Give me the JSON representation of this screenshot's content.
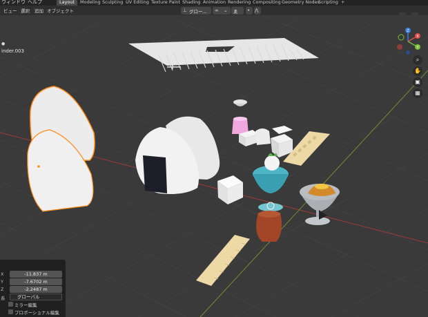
{
  "topbar": {
    "menus": [
      "ウィンドウ",
      "ヘルプ"
    ],
    "tabs": [
      "Layout",
      "Modeling",
      "Sculpting",
      "UV Editing",
      "Texture Paint",
      "Shading",
      "Animation",
      "Rendering",
      "Compositing",
      "Geometry Nodes",
      "Scripting"
    ],
    "active_tab": "Layout",
    "add_tab": "+"
  },
  "header": {
    "menus": [
      "ビュー",
      "選択",
      "追加",
      "オブジェクト"
    ],
    "orientation": "グロー...",
    "snap_label": "ゑ"
  },
  "viewport": {
    "object_name": "inder.003",
    "object_icon": "●",
    "nav_gizmo": {
      "x": "X",
      "y": "Y",
      "z": "Z"
    },
    "nav_buttons": [
      "zoom-icon",
      "hand-pan-icon",
      "camera-icon",
      "grid-icon"
    ]
  },
  "redo_panel": {
    "x_label": "X",
    "x_value": "-11.837 m",
    "y_label": "Y",
    "y_value": "-7.6702 m",
    "z_label": "Z",
    "z_value": "-2.2487 m",
    "orient_label": "系",
    "orient_value": "グローバル",
    "mirror_edit": "ミラー編集",
    "proportional_edit": "プロポーショナル編集"
  },
  "colors": {
    "background": "#3a3a3a",
    "grid": "#474747",
    "x_axis": "#a33a3a",
    "y_axis": "#7a9a3a",
    "selection": "#ff8c1a",
    "gizmo_x": "#e24c4c",
    "gizmo_y": "#7bbf3a",
    "gizmo_z": "#3c7de0"
  }
}
